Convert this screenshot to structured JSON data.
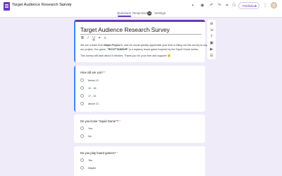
{
  "app": {
    "icon": "forms-icon",
    "title": "Target Audience Research Survey",
    "title_icons": [
      "folder-icon",
      "star-icon"
    ]
  },
  "tabs": [
    {
      "label": "Questions",
      "active": true
    },
    {
      "label": "Responses",
      "badge": "10"
    },
    {
      "label": "Settings"
    }
  ],
  "toolbar_right": {
    "icons": [
      "palette-icon",
      "preview-icon",
      "undo-icon",
      "redo-icon",
      "link-icon",
      "add-person-icon"
    ],
    "publish_label": "Published",
    "more_icon": "more-vert-icon"
  },
  "form": {
    "title": "Target Audience Research Survey",
    "format_icons": [
      "bold-icon",
      "italic-icon",
      "underline-icon",
      "link-icon",
      "clear-format-icon"
    ],
    "description_line1": "We are a team from ",
    "description_bold1": "Major Project 1",
    "description_line1b": ", and we would greatly appreciate your time in filling out this survey to support",
    "description_line2": "our project. Our game, ",
    "description_bold2": "\"RICOTTANEUR\"",
    "description_line2b": " is a mystery board game inspired by the Squid Game series.",
    "description_line3": "This survey will take about 5 minutes. Thank you for your time and support! 😊"
  },
  "questions": [
    {
      "text": "How old are you?",
      "required": "*",
      "options": [
        "below 12",
        "12 - 16",
        "17 - 21",
        "above 21"
      ]
    },
    {
      "text": "Do you know \"Squid Game\"?",
      "required": "*",
      "options": [
        "Yes",
        "No"
      ]
    },
    {
      "text": "Do you play board games?",
      "required": "*",
      "options": [
        "Yes",
        "Maybe"
      ]
    }
  ],
  "side_tools": [
    "add-question-icon",
    "import-icon",
    "title-text-icon",
    "image-icon",
    "video-icon",
    "section-icon"
  ],
  "colors": {
    "accent": "#673ab7",
    "active_border": "#4285f4",
    "background": "#f0ebf8"
  }
}
